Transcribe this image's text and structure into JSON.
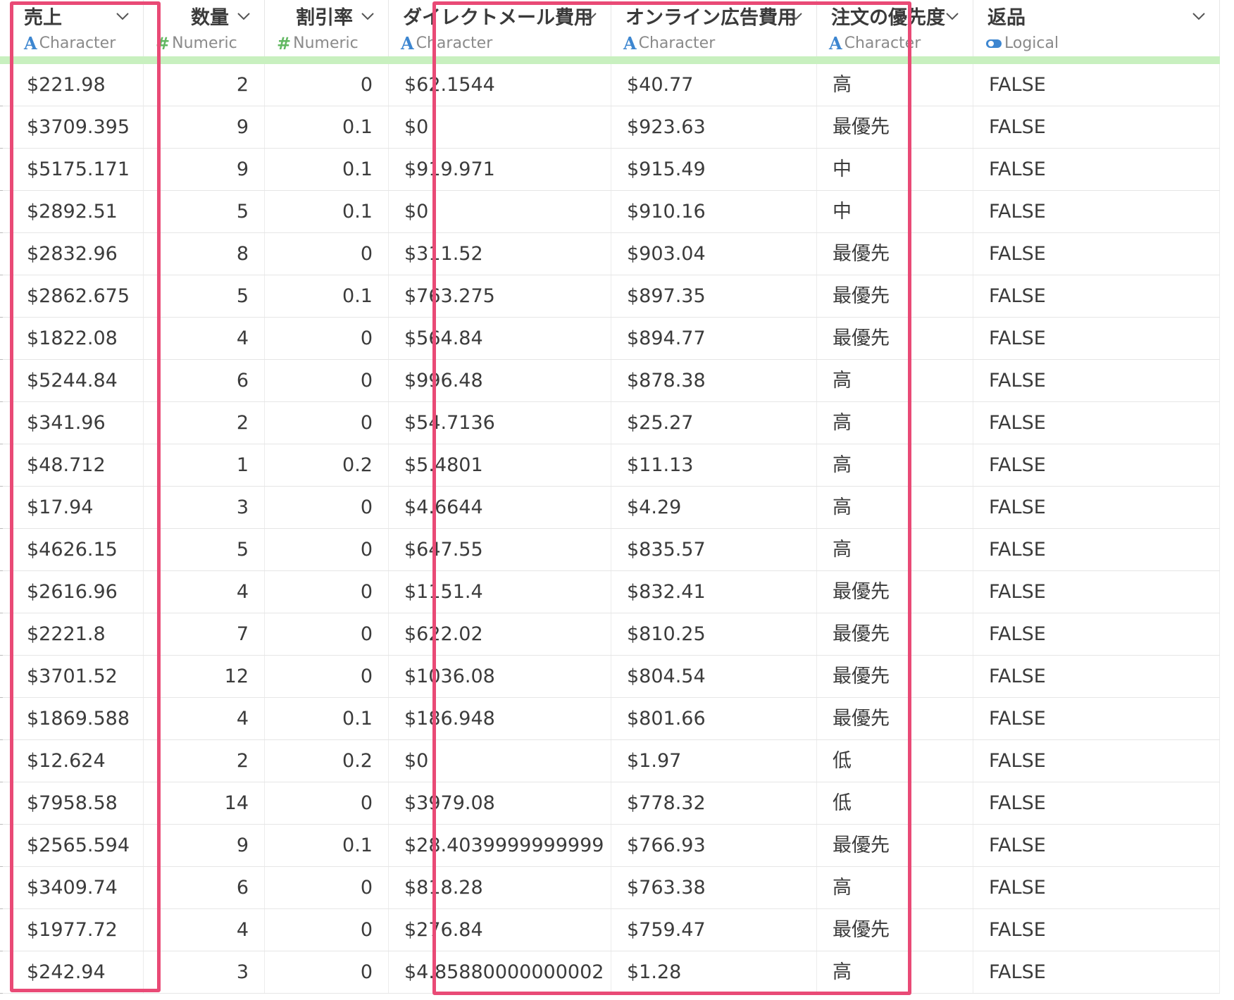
{
  "columns": [
    {
      "name": "売上",
      "type": "Character",
      "type_icon": "A",
      "align": "left"
    },
    {
      "name": "数量",
      "type": "Numeric",
      "type_icon": "#",
      "align": "right"
    },
    {
      "name": "割引率",
      "type": "Numeric",
      "type_icon": "#",
      "align": "right"
    },
    {
      "name": "ダイレクトメール費用",
      "type": "Character",
      "type_icon": "A",
      "align": "left"
    },
    {
      "name": "オンライン広告費用",
      "type": "Character",
      "type_icon": "A",
      "align": "left"
    },
    {
      "name": "注文の優先度",
      "type": "Character",
      "type_icon": "A",
      "align": "left"
    },
    {
      "name": "返品",
      "type": "Logical",
      "type_icon": "toggle-icon",
      "align": "left"
    }
  ],
  "rows": [
    [
      "$221.98",
      "2",
      "0",
      "$62.1544",
      "$40.77",
      "高",
      "FALSE"
    ],
    [
      "$3709.395",
      "9",
      "0.1",
      "$0",
      "$923.63",
      "最優先",
      "FALSE"
    ],
    [
      "$5175.171",
      "9",
      "0.1",
      "$919.971",
      "$915.49",
      "中",
      "FALSE"
    ],
    [
      "$2892.51",
      "5",
      "0.1",
      "$0",
      "$910.16",
      "中",
      "FALSE"
    ],
    [
      "$2832.96",
      "8",
      "0",
      "$311.52",
      "$903.04",
      "最優先",
      "FALSE"
    ],
    [
      "$2862.675",
      "5",
      "0.1",
      "$763.275",
      "$897.35",
      "最優先",
      "FALSE"
    ],
    [
      "$1822.08",
      "4",
      "0",
      "$564.84",
      "$894.77",
      "最優先",
      "FALSE"
    ],
    [
      "$5244.84",
      "6",
      "0",
      "$996.48",
      "$878.38",
      "高",
      "FALSE"
    ],
    [
      "$341.96",
      "2",
      "0",
      "$54.7136",
      "$25.27",
      "高",
      "FALSE"
    ],
    [
      "$48.712",
      "1",
      "0.2",
      "$5.4801",
      "$11.13",
      "高",
      "FALSE"
    ],
    [
      "$17.94",
      "3",
      "0",
      "$4.6644",
      "$4.29",
      "高",
      "FALSE"
    ],
    [
      "$4626.15",
      "5",
      "0",
      "$647.55",
      "$835.57",
      "高",
      "FALSE"
    ],
    [
      "$2616.96",
      "4",
      "0",
      "$1151.4",
      "$832.41",
      "最優先",
      "FALSE"
    ],
    [
      "$2221.8",
      "7",
      "0",
      "$622.02",
      "$810.25",
      "最優先",
      "FALSE"
    ],
    [
      "$3701.52",
      "12",
      "0",
      "$1036.08",
      "$804.54",
      "最優先",
      "FALSE"
    ],
    [
      "$1869.588",
      "4",
      "0.1",
      "$186.948",
      "$801.66",
      "最優先",
      "FALSE"
    ],
    [
      "$12.624",
      "2",
      "0.2",
      "$0",
      "$1.97",
      "低",
      "FALSE"
    ],
    [
      "$7958.58",
      "14",
      "0",
      "$3979.08",
      "$778.32",
      "低",
      "FALSE"
    ],
    [
      "$2565.594",
      "9",
      "0.1",
      "$28.4039999999999",
      "$766.93",
      "最優先",
      "FALSE"
    ],
    [
      "$3409.74",
      "6",
      "0",
      "$818.28",
      "$763.38",
      "高",
      "FALSE"
    ],
    [
      "$1977.72",
      "4",
      "0",
      "$276.84",
      "$759.47",
      "最優先",
      "FALSE"
    ],
    [
      "$242.94",
      "3",
      "0",
      "$4.85880000000002",
      "$1.28",
      "高",
      "FALSE"
    ]
  ],
  "highlighted_columns": [
    "売上",
    "ダイレクトメール費用",
    "オンライン広告費用"
  ],
  "colors": {
    "highlight": "#e94a76",
    "header_bar": "#c8f0bf",
    "character_icon": "#3d86d0",
    "numeric_icon": "#62b862",
    "logical_icon": "#3d86d0"
  }
}
